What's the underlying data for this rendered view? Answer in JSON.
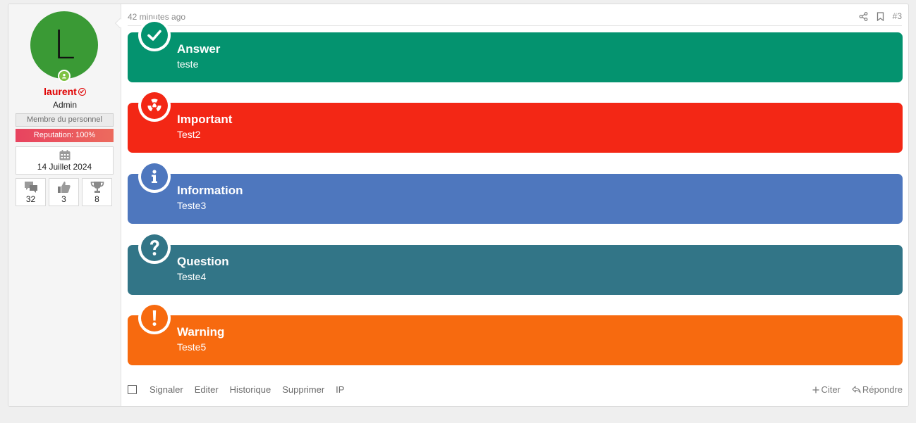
{
  "user": {
    "avatar_letter": "L",
    "avatar_color": "#3a9a35",
    "username": "laurent",
    "role": "Admin",
    "staff_banner": "Membre du personnel",
    "reputation": "Reputation: 100%",
    "joined_date": "14 Juillet 2024",
    "stats": [
      {
        "icon": "messages-icon",
        "value": "32"
      },
      {
        "icon": "thumbs-up-icon",
        "value": "3"
      },
      {
        "icon": "trophy-icon",
        "value": "8"
      }
    ]
  },
  "post": {
    "time": "42 minutes ago",
    "number": "#3"
  },
  "callouts": [
    {
      "title": "Answer",
      "body": "teste",
      "color": "#04936f",
      "icon": "check-icon"
    },
    {
      "title": "Important",
      "body": "Test2",
      "color": "#f32715",
      "icon": "radiation-icon"
    },
    {
      "title": "Information",
      "body": "Teste3",
      "color": "#4e77be",
      "icon": "info-icon"
    },
    {
      "title": "Question",
      "body": "Teste4",
      "color": "#327587",
      "icon": "question-icon"
    },
    {
      "title": "Warning",
      "body": "Teste5",
      "color": "#f76a0f",
      "icon": "exclamation-icon"
    }
  ],
  "footer": {
    "links": [
      "Signaler",
      "Editer",
      "Historique",
      "Supprimer",
      "IP"
    ],
    "quote": "Citer",
    "reply": "Répondre"
  }
}
